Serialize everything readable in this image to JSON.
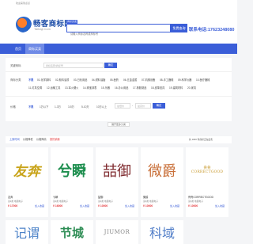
{
  "topbar": {
    "text": "欢迎来到点点",
    "right": "商标转让 注册商标 联系我们"
  },
  "logo": {
    "name": "畅客商标网",
    "sub": "Taihaji.Com"
  },
  "search": {
    "tab": "商标买卖",
    "placeholder": "请输入商标名称或商标号",
    "button": "免费查询"
  },
  "phone": "联系电话:17623248080",
  "nav": {
    "items": [
      "首页",
      "商标买卖"
    ],
    "active": 1
  },
  "filters": {
    "name_label": "关键商标",
    "name_placeholder": "商标名称/商标号",
    "name_button": "确定",
    "category_label": "商标分类",
    "categories": [
      "不限",
      "01-化学原料",
      "02-颜料油漆",
      "03-日化用品",
      "04-燃料油脂",
      "05-医药",
      "06-五金金属",
      "07-机械设备",
      "08-手工器械",
      "09-科学仪器",
      "10-医疗器械",
      "11-灯具空调",
      "12-运输工具",
      "13-军火烟火",
      "14-珠宝钟表",
      "15-乐器",
      "16-办公用品",
      "17-橡胶制品",
      "18-皮革皮具",
      "19-建筑材料",
      "20-家具"
    ],
    "active_category": 0,
    "price_label": "价格",
    "prices": [
      "不限",
      "1万以下",
      "1-3万",
      "3-5万",
      "5-10万",
      "10万以上"
    ],
    "active_price": 0,
    "price_min_placeholder": "最低价",
    "price_max_placeholder": "最高价",
    "price_button": "确定",
    "price_sep": "-",
    "toggle": "展开更多分类"
  },
  "sort": {
    "items": [
      "上架时间",
      "价格降低",
      "价格降高",
      "按热销量"
    ],
    "active": 0,
    "total": "共 1000 件商标正在出售"
  },
  "products": [
    {
      "mark": "友奔",
      "name": "友奔",
      "cat": "第9类 电器电子",
      "price": "¥ 17000",
      "link": "加入收藏"
    },
    {
      "mark": "兮瞬",
      "name": "兮瞬",
      "cat": "第9类 电器电子",
      "price": "¥ 16000",
      "link": "加入收藏"
    },
    {
      "mark": "喆御",
      "name": "喆御",
      "cat": "第9类 电器电子",
      "price": "¥ 10000",
      "link": "加入收藏"
    },
    {
      "mark": "微爵",
      "name": "微爵",
      "cat": "第9类 电器电子",
      "price": "¥ 10000",
      "link": "加入收藏"
    },
    {
      "mark_top": "骨骨",
      "mark_bottom": "CORRECTGOOD",
      "name": "骨骨CORRECTGOOD",
      "cat": "第9类 电器电子",
      "price": "¥ 10000",
      "link": "加入收藏"
    }
  ],
  "products_row2": [
    {
      "mark": "记谓"
    },
    {
      "mark": "节城"
    },
    {
      "mark": "JIUMOR"
    },
    {
      "mark": "科域"
    }
  ],
  "colors": {
    "brand": "#3b5ed8",
    "price": "#e4393c"
  }
}
